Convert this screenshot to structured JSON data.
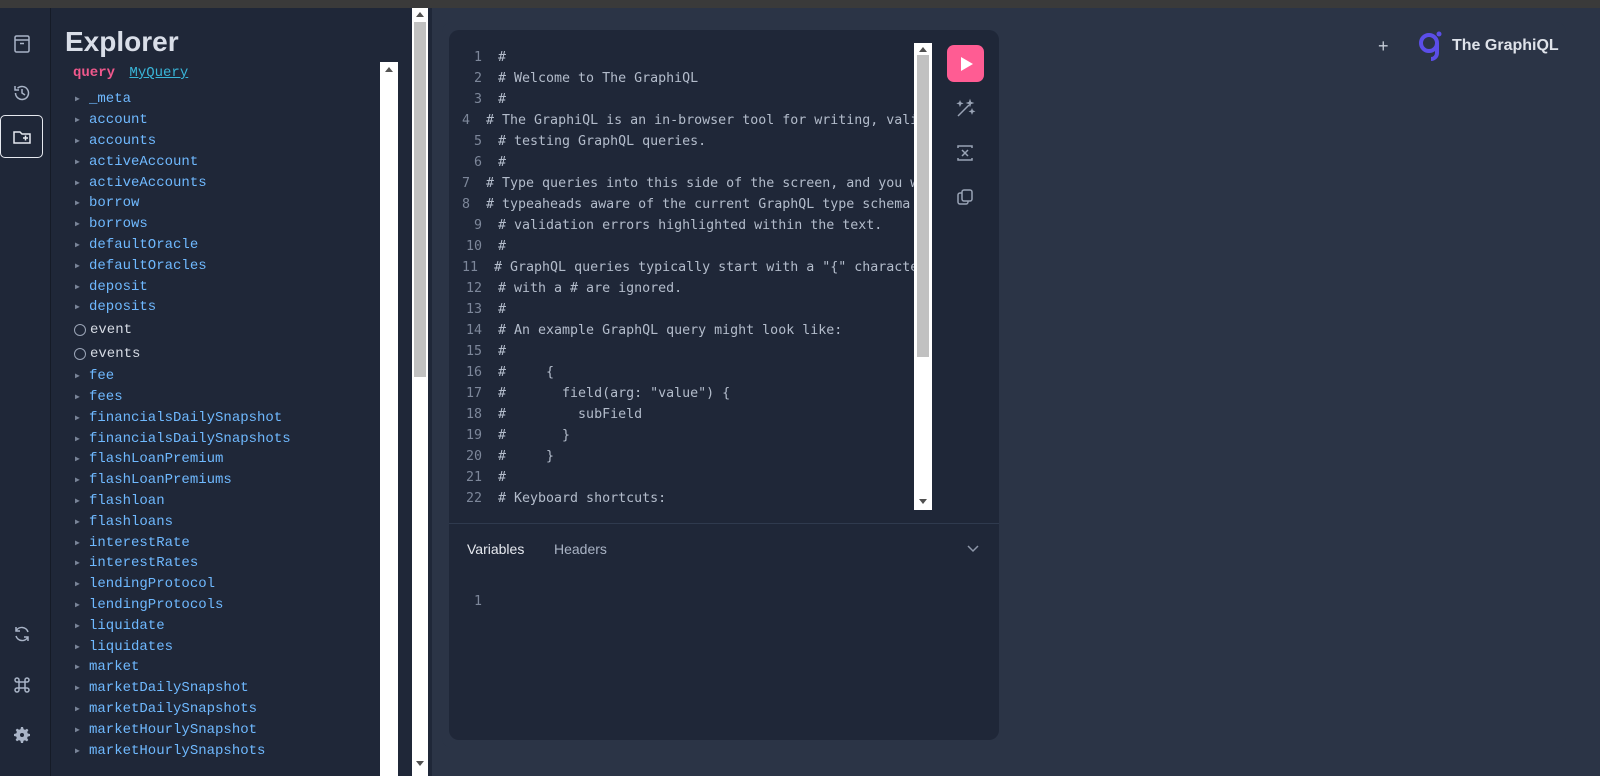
{
  "app": {
    "logo_text": "The GraphiQL",
    "new_tab_label": "+"
  },
  "sidebar": {
    "items": [
      {
        "icon": "docs-icon"
      },
      {
        "icon": "history-icon"
      },
      {
        "icon": "explorer-folder-icon",
        "active": true
      },
      {
        "icon": "refetch-schema-icon"
      },
      {
        "icon": "shortcuts-icon"
      },
      {
        "icon": "settings-icon"
      }
    ]
  },
  "explorer": {
    "title": "Explorer",
    "operation_keyword": "query",
    "operation_name": "MyQuery",
    "fields": [
      {
        "name": "_meta",
        "kind": "object"
      },
      {
        "name": "account",
        "kind": "object"
      },
      {
        "name": "accounts",
        "kind": "object"
      },
      {
        "name": "activeAccount",
        "kind": "object"
      },
      {
        "name": "activeAccounts",
        "kind": "object"
      },
      {
        "name": "borrow",
        "kind": "object"
      },
      {
        "name": "borrows",
        "kind": "object"
      },
      {
        "name": "defaultOracle",
        "kind": "object"
      },
      {
        "name": "defaultOracles",
        "kind": "object"
      },
      {
        "name": "deposit",
        "kind": "object"
      },
      {
        "name": "deposits",
        "kind": "object"
      },
      {
        "name": "event",
        "kind": "scalar"
      },
      {
        "name": "events",
        "kind": "scalar"
      },
      {
        "name": "fee",
        "kind": "object"
      },
      {
        "name": "fees",
        "kind": "object"
      },
      {
        "name": "financialsDailySnapshot",
        "kind": "object"
      },
      {
        "name": "financialsDailySnapshots",
        "kind": "object"
      },
      {
        "name": "flashLoanPremium",
        "kind": "object"
      },
      {
        "name": "flashLoanPremiums",
        "kind": "object"
      },
      {
        "name": "flashloan",
        "kind": "object"
      },
      {
        "name": "flashloans",
        "kind": "object"
      },
      {
        "name": "interestRate",
        "kind": "object"
      },
      {
        "name": "interestRates",
        "kind": "object"
      },
      {
        "name": "lendingProtocol",
        "kind": "object"
      },
      {
        "name": "lendingProtocols",
        "kind": "object"
      },
      {
        "name": "liquidate",
        "kind": "object"
      },
      {
        "name": "liquidates",
        "kind": "object"
      },
      {
        "name": "market",
        "kind": "object"
      },
      {
        "name": "marketDailySnapshot",
        "kind": "object"
      },
      {
        "name": "marketDailySnapshots",
        "kind": "object"
      },
      {
        "name": "marketHourlySnapshot",
        "kind": "object"
      },
      {
        "name": "marketHourlySnapshots",
        "kind": "object"
      }
    ]
  },
  "editor": {
    "lines": [
      "#",
      "# Welcome to The GraphiQL",
      "#",
      "# The GraphiQL is an in-browser tool for writing, validating, and",
      "# testing GraphQL queries.",
      "#",
      "# Type queries into this side of the screen, and you will see intelligent",
      "# typeaheads aware of the current GraphQL type schema and live syntax and",
      "# validation errors highlighted within the text.",
      "#",
      "# GraphQL queries typically start with a \"{\" character. Lines that start",
      "# with a # are ignored.",
      "#",
      "# An example GraphQL query might look like:",
      "#",
      "#     {",
      "#       field(arg: \"value\") {",
      "#         subField",
      "#       }",
      "#     }",
      "#",
      "# Keyboard shortcuts:"
    ]
  },
  "toolbar": {
    "run_icon": "play-icon",
    "prettify_icon": "prettify-icon",
    "merge_icon": "merge-fragments-icon",
    "copy_icon": "copy-icon"
  },
  "variables_panel": {
    "tabs": [
      "Variables",
      "Headers"
    ],
    "active_tab": "Variables",
    "line_number": "1"
  }
}
